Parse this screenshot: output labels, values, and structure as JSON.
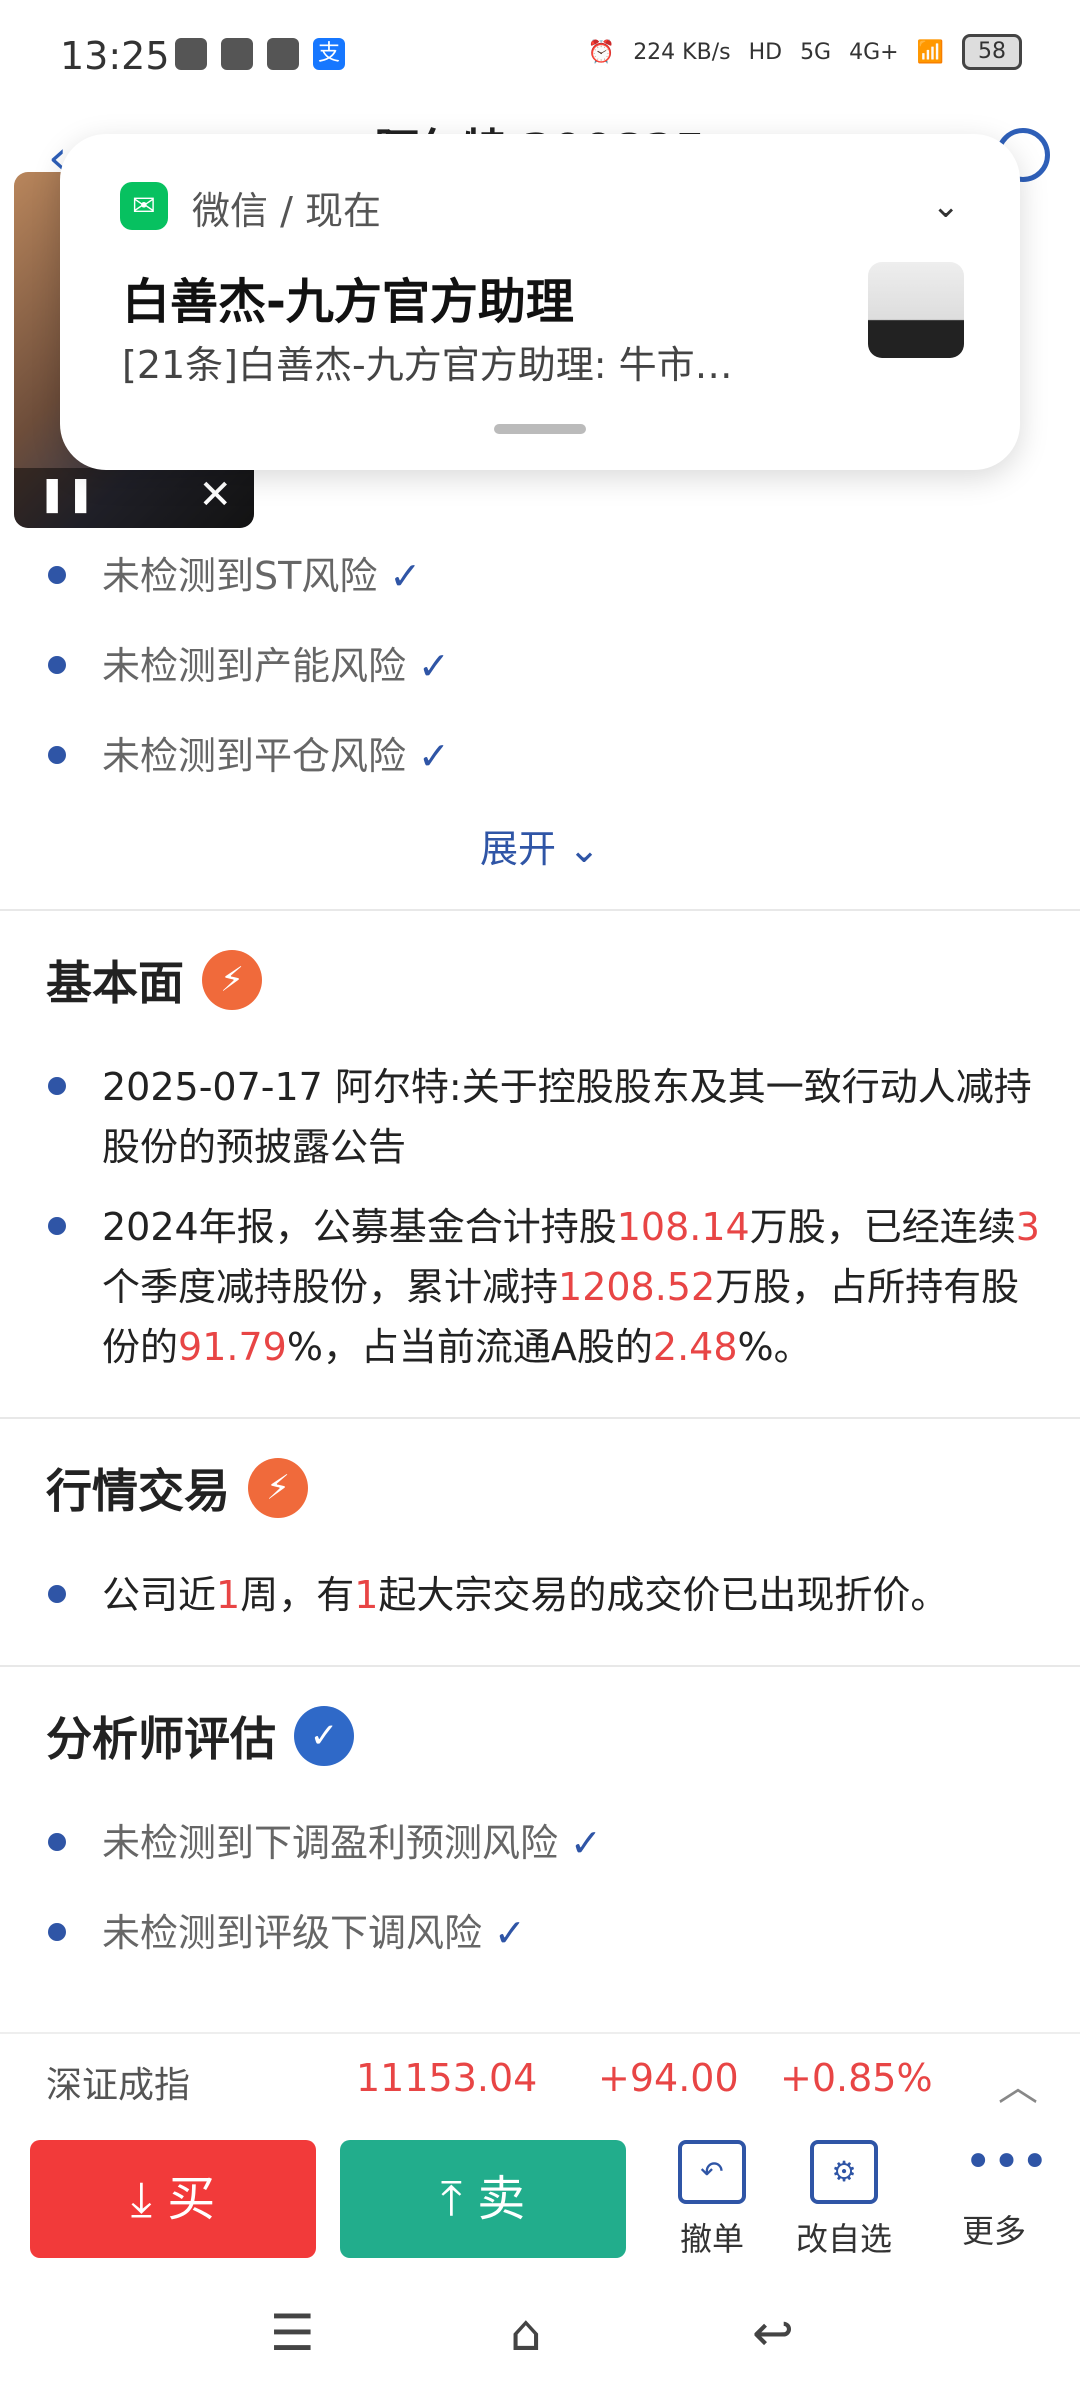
{
  "status_bar": {
    "time": "13:25",
    "net_speed": "224 KB/s",
    "signal_1": "5G",
    "signal_2": "4G+",
    "battery": "58",
    "alipay_glyph": "支"
  },
  "header": {
    "title": "阿尔特 300825"
  },
  "notification": {
    "app": "微信",
    "time": "现在",
    "sender": "白善杰-九方官方助理",
    "message": "[21条]白善杰-九方官方助理: 牛市…"
  },
  "risk_checks": [
    {
      "text": "未检测到ST风险",
      "check": "✓"
    },
    {
      "text": "未检测到产能风险",
      "check": "✓"
    },
    {
      "text": "未检测到平仓风险",
      "check": "✓"
    }
  ],
  "expand_label": "展开",
  "fundamentals": {
    "title": "基本面",
    "item1": "2025-07-17 阿尔特:关于控股股东及其一致行动人减持股份的预披露公告",
    "item2": {
      "p1": "2024年报，公募基金合计持股",
      "v1": "108.14",
      "p2": "万股，已经连续",
      "v2": "3",
      "p3": "个季度减持股份，累计减持",
      "v3": "1208.52",
      "p4": "万股，占所持有股份的",
      "v4": "91.79",
      "p5": "%，占当前流通A股的",
      "v5": "2.48",
      "p6": "%。"
    }
  },
  "trading": {
    "title": "行情交易",
    "p1": "公司近",
    "v1": "1",
    "p2": "周，有",
    "v2": "1",
    "p3": "起大宗交易的成交价已出现折价。"
  },
  "analyst": {
    "title": "分析师评估",
    "items": [
      {
        "text": "未检测到下调盈利预测风险",
        "check": "✓"
      },
      {
        "text": "未检测到评级下调风险",
        "check": "✓"
      }
    ]
  },
  "quote": {
    "name": "深证成指",
    "value": "11153.04",
    "change": "+94.00",
    "change_pct": "+0.85%"
  },
  "actions": {
    "buy": "买",
    "sell": "卖",
    "cancel": "撤单",
    "edit_watch": "改自选",
    "more": "更多"
  },
  "icons": {
    "wechat": "wechat-icon",
    "search": "search-icon",
    "back": "back-icon",
    "warn_badge": "alert-icon",
    "shield_badge": "shield-icon"
  },
  "colors": {
    "accent_blue": "#2f55a6",
    "red": "#e84545",
    "buy_red": "#f23a3a",
    "sell_green": "#22ad8c",
    "wechat_green": "#07c160"
  }
}
